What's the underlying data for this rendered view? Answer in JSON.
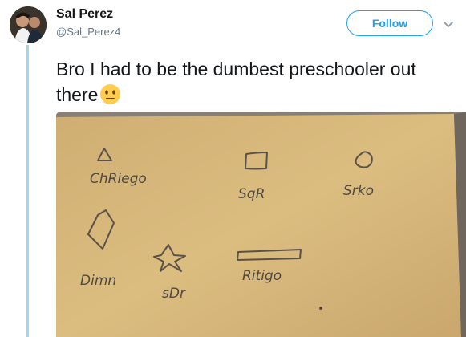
{
  "tweet": {
    "author": {
      "name": "Sal Perez",
      "handle": "@Sal_Perez4",
      "avatar_icon": "profile-photo-avatar"
    },
    "follow_label": "Follow",
    "text": "Bro I had to be the dumbest preschooler out there",
    "emoji": "neutral-face-emoji",
    "menu_icon": "chevron-down-icon",
    "media": {
      "description_kind": "photo of handwritten shapes on paper",
      "labels": {
        "triangle": "ChRiego",
        "square": "SqR",
        "circle": "Srko",
        "diamond": "Dimn",
        "star": "sDr",
        "rectangle": "Ritigo"
      }
    }
  },
  "colors": {
    "accent": "#1da1f2",
    "thread_line": "#9fd6f4",
    "paper": "#d9b87a",
    "background": "#8f8478"
  }
}
